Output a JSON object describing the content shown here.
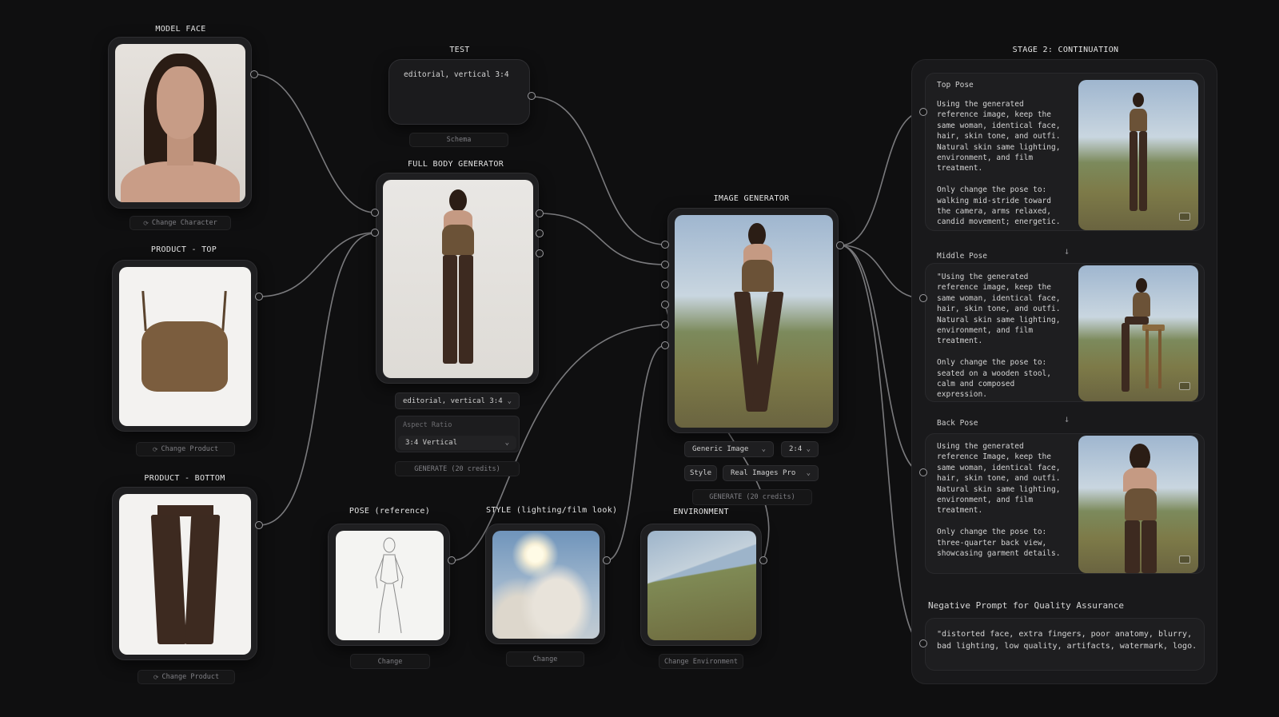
{
  "colors": {
    "background": "#0f0f10",
    "node": "#1f1f21",
    "wire": "#8d8d90",
    "text": "#d8d8d8",
    "muted": "#7f7f84"
  },
  "nodes": {
    "model_face": {
      "title": "MODEL FACE",
      "button": "Change Character",
      "button_icon": "refresh-icon"
    },
    "product_top": {
      "title": "PRODUCT - TOP",
      "button": "Change Product",
      "button_icon": "refresh-icon"
    },
    "product_bottom": {
      "title": "PRODUCT - BOTTOM",
      "button": "Change Product",
      "button_icon": "refresh-icon"
    },
    "test": {
      "title": "TEST",
      "text": "editorial, vertical 3:4",
      "footer": "Schema"
    },
    "full_body": {
      "title": "FULL BODY GENERATOR",
      "preset": "editorial, vertical 3:4",
      "aspect_label": "Aspect Ratio",
      "aspect_value": "3:4 Vertical",
      "generate": "GENERATE (20 credits)"
    },
    "pose": {
      "title": "POSE (reference)",
      "button": "Change"
    },
    "style": {
      "title": "STYLE (lighting/film look)",
      "button": "Change"
    },
    "environment": {
      "title": "ENVIRONMENT",
      "button": "Change Environment"
    },
    "image_generator": {
      "title": "IMAGE GENERATOR",
      "model": "Generic Image",
      "ratio": "2:4",
      "style_label": "Style",
      "style_value": "Real Images Pro",
      "generate": "GENERATE (20 credits)"
    }
  },
  "stage2": {
    "title": "STAGE 2: CONTINUATION",
    "poses": [
      {
        "label": "Top Pose",
        "text": "Using the generated reference image, keep the same woman, identical face, hair, skin tone, and outfi. Natural skin same lighting, environment, and film treatment.\n\nOnly change the pose to: walking mid-stride toward the camera, arms relaxed, candid movement; energetic."
      },
      {
        "label": "Middle Pose",
        "text": "\"Using the generated reference image, keep the same woman, identical face, hair, skin tone, and outfi. Natural skin same lighting, environment, and film treatment.\n\nOnly change the pose to: seated on a wooden stool, calm and composed expression."
      },
      {
        "label": "Back Pose",
        "text": "Using the generated reference Image, keep the same woman, identical face, hair, skin tone, and outfi. Natural skin same lighting, environment, and film treatment.\n\nOnly change the pose to: three-quarter back view, showcasing garment details."
      }
    ],
    "negative_label": "Negative Prompt for Quality Assurance",
    "negative_text": "\"distorted face, extra fingers, poor anatomy, blurry, bad lighting, low quality, artifacts, watermark, logo."
  }
}
